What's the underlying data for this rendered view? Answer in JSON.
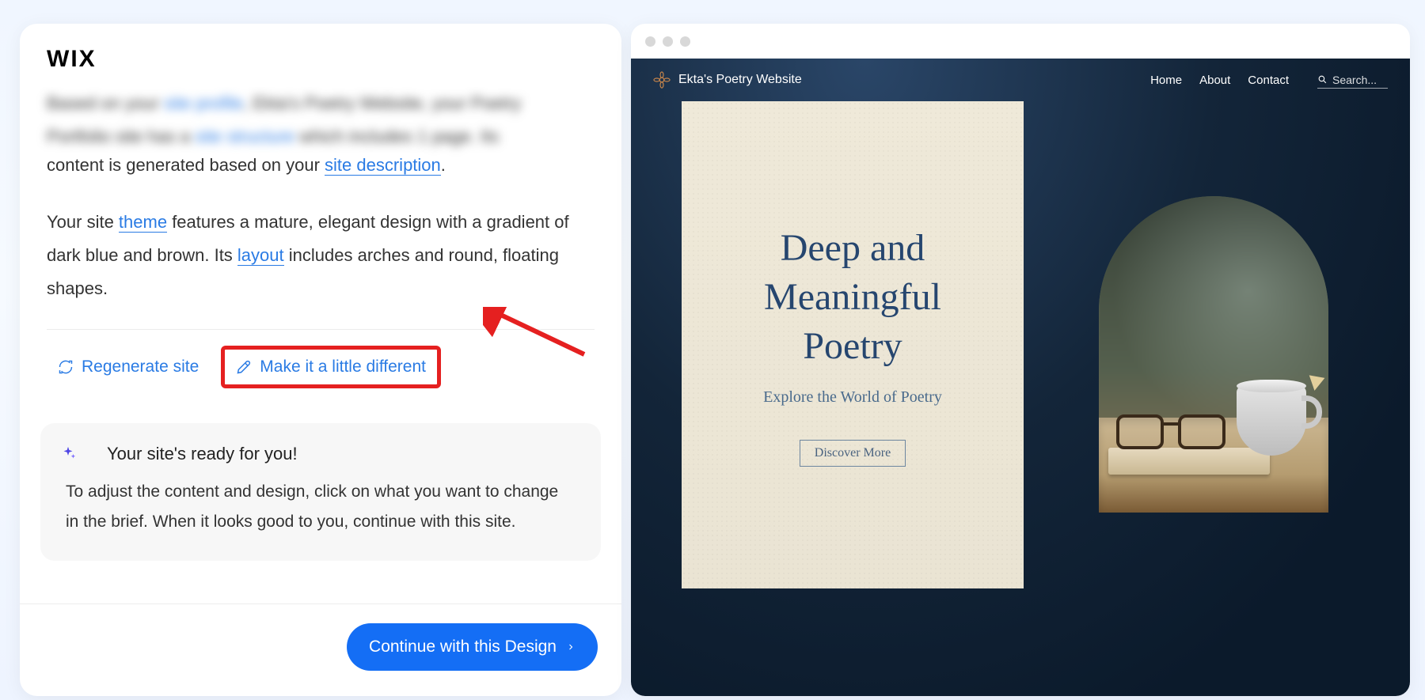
{
  "logo": "WIX",
  "para_blur_1a": "Based on your ",
  "para_blur_link1": "site profile",
  "para_blur_1b": ", Ekta's Poetry Website, your Poetry",
  "para_blur_2a": "Portfolio site has a ",
  "para_blur_link2": "site structure",
  "para_blur_2b": " which includes 1 page. Its",
  "para1_a": "content is generated based on your ",
  "para1_link": "site description",
  "para1_b": ".",
  "para2_a": "Your site ",
  "para2_link1": "theme",
  "para2_b": " features a mature, elegant design with a gradient of dark blue and brown. Its ",
  "para2_link2": "layout",
  "para2_c": " includes arches and round, floating shapes.",
  "actions": {
    "regenerate": "Regenerate site",
    "tweak": "Make it a little different"
  },
  "ready": {
    "title": "Your site's ready for you!",
    "body": "To adjust the content and design, click on what you want to change in the brief. When it looks good to you, continue with this site."
  },
  "footer_btn": "Continue with this Design",
  "preview": {
    "brand": "Ekta's Poetry Website",
    "nav": {
      "home": "Home",
      "about": "About",
      "contact": "Contact"
    },
    "search_placeholder": "Search...",
    "poster": {
      "title_l1": "Deep and",
      "title_l2": "Meaningful",
      "title_l3": "Poetry",
      "subtitle": "Explore the World of Poetry",
      "cta": "Discover More"
    }
  }
}
